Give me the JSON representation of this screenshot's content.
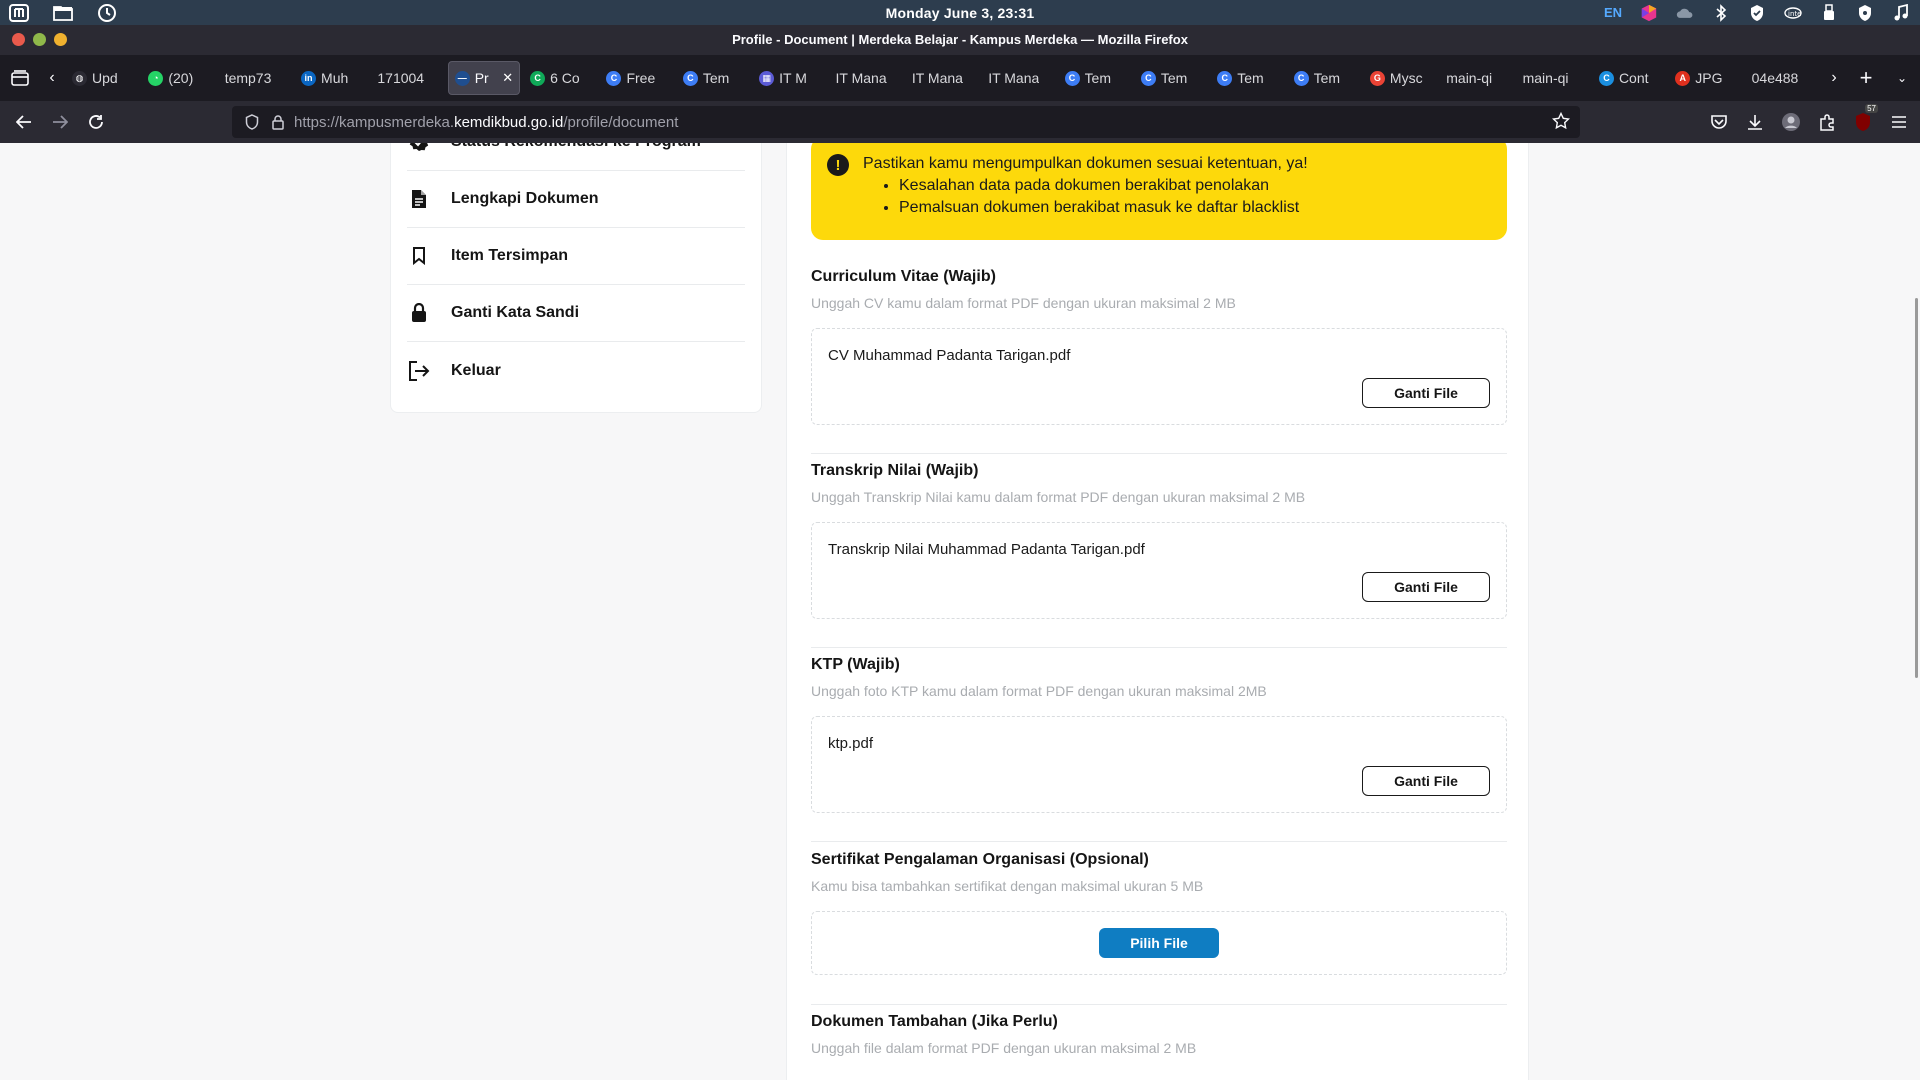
{
  "system_bar": {
    "clock": "Monday June 3, 23:31",
    "lang": "EN"
  },
  "window": {
    "title": "Profile - Document | Merdeka Belajar - Kampus Merdeka — Mozilla Firefox"
  },
  "tabs": [
    {
      "label": "Upd",
      "fav_color": "#2b2a33",
      "fav_text": "◍"
    },
    {
      "label": "(20)",
      "fav_color": "#25d366",
      "fav_text": "◔"
    },
    {
      "label": "temp73",
      "fav_color": "",
      "fav_text": ""
    },
    {
      "label": "Muh",
      "fav_color": "#0a66c2",
      "fav_text": "in"
    },
    {
      "label": "171004",
      "fav_color": "",
      "fav_text": ""
    },
    {
      "label": "Pr",
      "fav_color": "#1f4e8f",
      "fav_text": "—",
      "active": true
    },
    {
      "label": "6 Co",
      "fav_color": "#0fa958",
      "fav_text": "C"
    },
    {
      "label": "Free",
      "fav_color": "#3d7df5",
      "fav_text": "C"
    },
    {
      "label": "Tem",
      "fav_color": "#3d7df5",
      "fav_text": "C"
    },
    {
      "label": "IT M",
      "fav_color": "#5b5bd6",
      "fav_text": "▦"
    },
    {
      "label": "IT Mana",
      "fav_color": "",
      "fav_text": ""
    },
    {
      "label": "IT Mana",
      "fav_color": "",
      "fav_text": ""
    },
    {
      "label": "IT Mana",
      "fav_color": "",
      "fav_text": ""
    },
    {
      "label": "Tem",
      "fav_color": "#3d7df5",
      "fav_text": "C"
    },
    {
      "label": "Tem",
      "fav_color": "#3d7df5",
      "fav_text": "C"
    },
    {
      "label": "Tem",
      "fav_color": "#3d7df5",
      "fav_text": "C"
    },
    {
      "label": "Tem",
      "fav_color": "#3d7df5",
      "fav_text": "C"
    },
    {
      "label": "Mysc",
      "fav_color": "#ea4335",
      "fav_text": "G"
    },
    {
      "label": "main-qi",
      "fav_color": "",
      "fav_text": ""
    },
    {
      "label": "main-qi",
      "fav_color": "",
      "fav_text": ""
    },
    {
      "label": "Cont",
      "fav_color": "#1b8fe0",
      "fav_text": "C"
    },
    {
      "label": "JPG",
      "fav_color": "#e0301e",
      "fav_text": "A"
    },
    {
      "label": "04e488",
      "fav_color": "",
      "fav_text": ""
    }
  ],
  "url": {
    "prefix": "https://kampusmerdeka.",
    "domain": "kemdikbud.go.id",
    "path": "/profile/document"
  },
  "extension_badge": "57",
  "sidebar": {
    "items": [
      {
        "label": "Status Rekomendasi ke Program",
        "icon": "verified-badge-icon"
      },
      {
        "label": "Lengkapi Dokumen",
        "icon": "document-icon"
      },
      {
        "label": "Item Tersimpan",
        "icon": "bookmark-icon"
      },
      {
        "label": "Ganti Kata Sandi",
        "icon": "lock-icon"
      },
      {
        "label": "Keluar",
        "icon": "logout-icon"
      }
    ]
  },
  "alert": {
    "heading": "Pastikan kamu mengumpulkan dokumen sesuai ketentuan, ya!",
    "points": [
      "Kesalahan data pada dokumen berakibat penolakan",
      "Pemalsuan dokumen berakibat masuk ke daftar blacklist"
    ]
  },
  "documents": [
    {
      "title": "Curriculum Vitae (Wajib)",
      "desc": "Unggah CV kamu dalam format PDF dengan ukuran maksimal 2 MB",
      "file": "CV Muhammad Padanta Tarigan.pdf",
      "button": "Ganti File"
    },
    {
      "title": "Transkrip Nilai (Wajib)",
      "desc": "Unggah Transkrip Nilai kamu dalam format PDF dengan ukuran maksimal 2 MB",
      "file": "Transkrip Nilai Muhammad Padanta Tarigan.pdf",
      "button": "Ganti File"
    },
    {
      "title": "KTP (Wajib)",
      "desc": "Unggah foto KTP kamu dalam format PDF dengan ukuran maksimal 2MB",
      "file": "ktp.pdf",
      "button": "Ganti File"
    },
    {
      "title": "Sertifikat Pengalaman Organisasi (Opsional)",
      "desc": "Kamu bisa tambahkan sertifikat dengan maksimal ukuran 5 MB",
      "file": "",
      "button": "Pilih File"
    },
    {
      "title": "Dokumen Tambahan (Jika Perlu)",
      "desc": "Unggah file dalam format PDF dengan ukuran maksimal 2 MB"
    }
  ],
  "colors": {
    "alert_bg": "#fdd90b",
    "primary_button": "#0f7dc2"
  }
}
